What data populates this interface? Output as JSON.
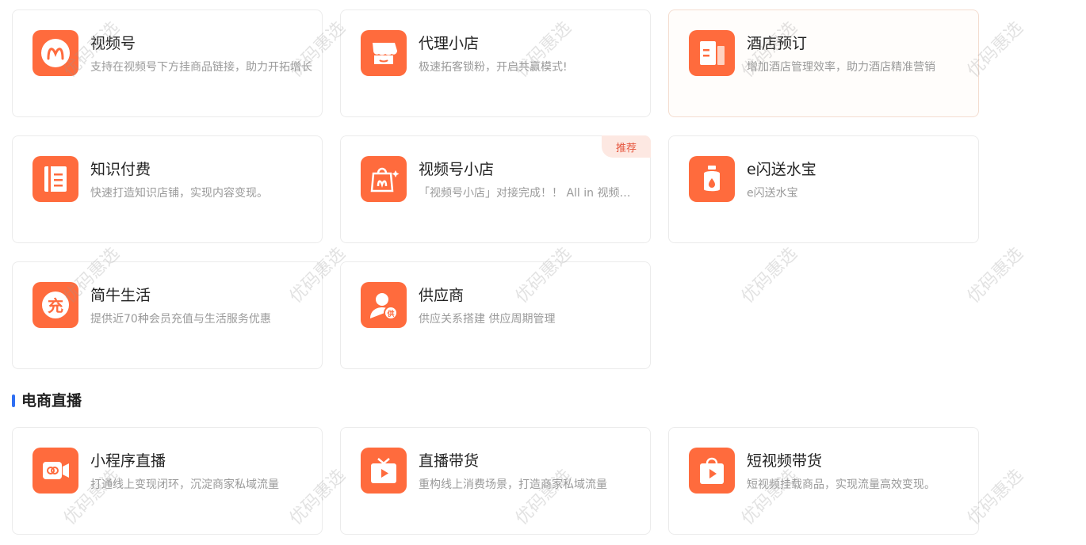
{
  "brand_color": "#ff6b3d",
  "section_accent": "#2f6ff3",
  "watermark_text": "优码惠选",
  "cards": [
    {
      "title": "视频号",
      "desc": "支持在视频号下方挂商品链接，助力开拓增长",
      "icon": "video-channel-icon"
    },
    {
      "title": "代理小店",
      "desc": "极速拓客锁粉，开启共赢模式!",
      "icon": "store-icon"
    },
    {
      "title": "酒店预订",
      "desc": "增加酒店管理效率，助力酒店精准营销",
      "icon": "hotel-icon"
    },
    {
      "title": "知识付费",
      "desc": "快速打造知识店铺，实现内容变现。",
      "icon": "knowledge-book-icon"
    },
    {
      "title": "视频号小店",
      "desc": "「视频号小店」对接完成！！ All in 视频号小店",
      "icon": "video-shop-bag-icon",
      "badge": "推荐"
    },
    {
      "title": "e闪送水宝",
      "desc": "e闪送水宝",
      "icon": "water-bottle-icon"
    },
    {
      "title": "简牛生活",
      "desc": "提供近70种会员充值与生活服务优惠",
      "icon": "recharge-icon"
    },
    {
      "title": "供应商",
      "desc": "供应关系搭建 供应周期管理",
      "icon": "supplier-icon"
    }
  ],
  "section": {
    "title": "电商直播",
    "cards": [
      {
        "title": "小程序直播",
        "desc": "打通线上变现闭环，沉淀商家私域流量",
        "icon": "mini-program-live-icon"
      },
      {
        "title": "直播带货",
        "desc": "重构线上消费场景，打造商家私域流量",
        "icon": "live-tv-icon"
      },
      {
        "title": "短视频带货",
        "desc": "短视频挂载商品，实现流量高效变现。",
        "icon": "short-video-bag-icon"
      }
    ]
  }
}
